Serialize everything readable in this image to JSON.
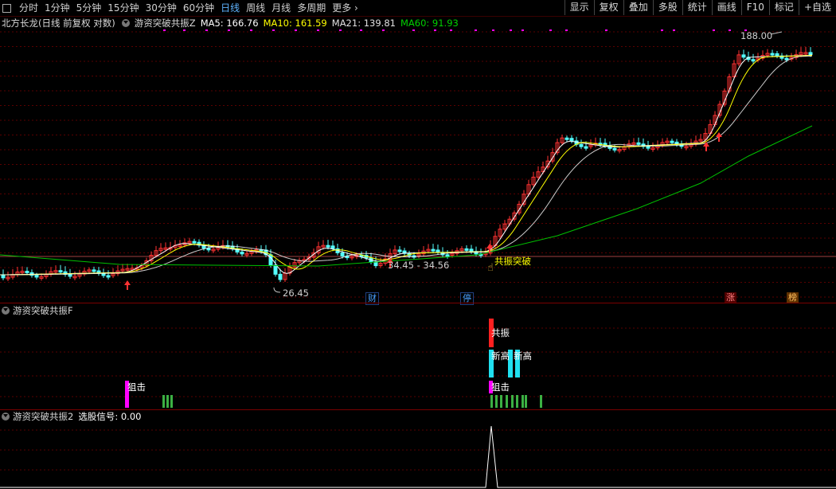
{
  "toolbar": {
    "periods": [
      "分时",
      "1分钟",
      "5分钟",
      "15分钟",
      "30分钟",
      "60分钟",
      "日线",
      "周线",
      "月线",
      "多周期",
      "更多"
    ],
    "active_period": "日线",
    "buttons": [
      "显示",
      "复权",
      "叠加",
      "多股",
      "统计",
      "画线",
      "F10",
      "标记",
      "+自选"
    ]
  },
  "main_panel": {
    "title": "北方长龙(日线 前复权 对数)",
    "indicator": "游资突破共振Z",
    "ma5": "MA5: 166.76",
    "ma10": "MA10: 161.59",
    "ma21": "MA21: 139.81",
    "ma60": "MA60: 91.93",
    "high_label": "188.00",
    "low_label": "26.45",
    "range_label": "34.45 - 34.56",
    "signal_label": "共振突破",
    "badges": [
      "财",
      "停",
      "涨",
      "榜"
    ]
  },
  "panel2": {
    "title": "游资突破共振F",
    "labels": [
      "共振",
      "新高",
      "新高",
      "狙击",
      "狙击"
    ]
  },
  "panel3": {
    "title": "游资突破共振2",
    "signal": "选股信号: 0.00"
  },
  "colors": {
    "up": "#ff3232",
    "down": "#54ffff",
    "ma5": "#ffffff",
    "ma10": "#ffff00",
    "ma21": "#ffffff",
    "ma60": "#00c000",
    "magenta": "#ff00ff",
    "green_bar": "#3cb043",
    "grid": "#5a0000"
  }
}
